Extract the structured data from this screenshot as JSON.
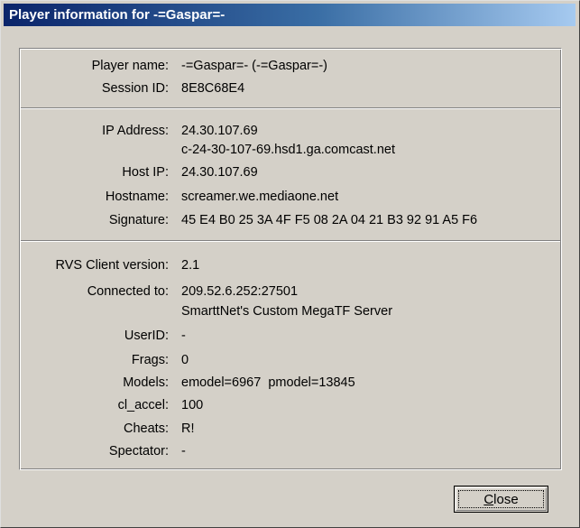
{
  "window": {
    "title": "Player information for -=Gaspar=-"
  },
  "section1": {
    "player_name_label": "Player name:",
    "player_name_value": "-=Gaspar=- (-=Gaspar=-)",
    "session_id_label": "Session ID:",
    "session_id_value": "8E8C68E4"
  },
  "section2": {
    "ip_address_label": "IP Address:",
    "ip_address_value": "24.30.107.69",
    "ip_address_host": "c-24-30-107-69.hsd1.ga.comcast.net",
    "host_ip_label": "Host IP:",
    "host_ip_value": "24.30.107.69",
    "hostname_label": "Hostname:",
    "hostname_value": "screamer.we.mediaone.net",
    "signature_label": "Signature:",
    "signature_value": "45 E4 B0 25 3A 4F F5 08 2A 04 21 B3 92 91 A5 F6"
  },
  "section3": {
    "rvs_version_label": "RVS Client version:",
    "rvs_version_value": "2.1",
    "connected_label": "Connected to:",
    "connected_value": "209.52.6.252:27501",
    "connected_server": "SmarttNet's Custom MegaTF Server",
    "userid_label": "UserID:",
    "userid_value": "-",
    "frags_label": "Frags:",
    "frags_value": "0",
    "models_label": "Models:",
    "models_value": "emodel=6967  pmodel=13845",
    "cl_accel_label": "cl_accel:",
    "cl_accel_value": "100",
    "cheats_label": "Cheats:",
    "cheats_value": "R!",
    "spectator_label": "Spectator:",
    "spectator_value": "-"
  },
  "buttons": {
    "close_mnemonic": "C",
    "close_rest": "lose"
  },
  "colors": {
    "titlebar_start": "#0a246a",
    "titlebar_end": "#a6caf0",
    "face": "#d4d0c8"
  }
}
